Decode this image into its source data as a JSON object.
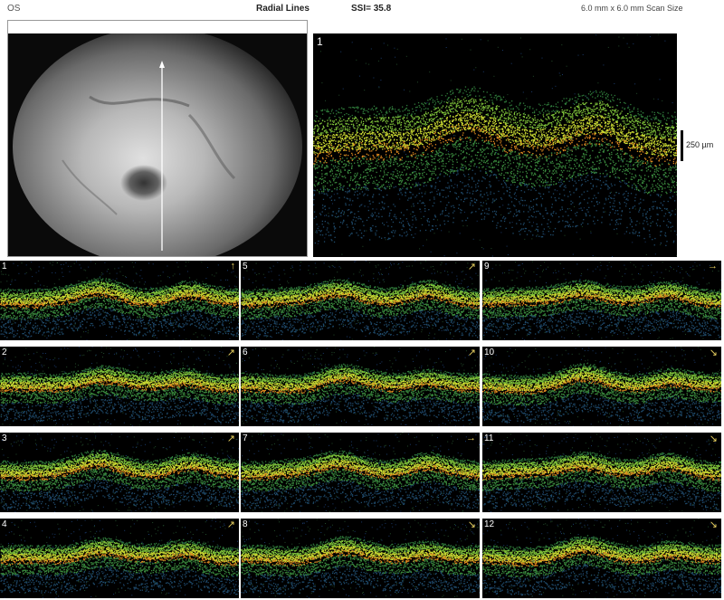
{
  "header": {
    "eye": "OS",
    "protocol": "Radial Lines",
    "ssi": "SSI= 35.8",
    "scan_size": "6.0 mm x 6.0 mm Scan Size"
  },
  "main_scan": {
    "number": "1"
  },
  "scale_bar": {
    "label": "250 µm"
  },
  "thumbnails": [
    {
      "number": "1",
      "arrow": "↑"
    },
    {
      "number": "5",
      "arrow": "↗"
    },
    {
      "number": "9",
      "arrow": "→"
    },
    {
      "number": "2",
      "arrow": "↗"
    },
    {
      "number": "6",
      "arrow": "↗"
    },
    {
      "number": "10",
      "arrow": "↘"
    },
    {
      "number": "3",
      "arrow": "↗"
    },
    {
      "number": "7",
      "arrow": "→"
    },
    {
      "number": "11",
      "arrow": "↘"
    },
    {
      "number": "4",
      "arrow": "↗"
    },
    {
      "number": "8",
      "arrow": "↘"
    },
    {
      "number": "12",
      "arrow": "↘"
    }
  ]
}
